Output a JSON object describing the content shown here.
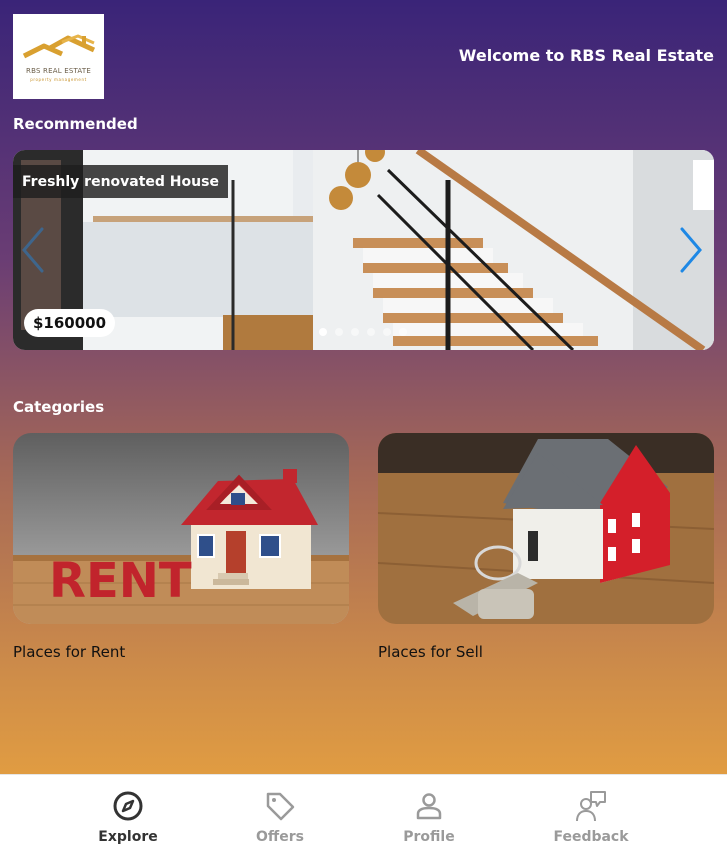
{
  "header": {
    "logo": {
      "name": "RBS REAL ESTATE",
      "tagline": "property management"
    },
    "welcome": "Welcome to RBS Real Estate"
  },
  "recommended": {
    "title": "Recommended",
    "active_slide": 0,
    "slide_count": 6,
    "slides": [
      {
        "caption": "Freshly renovated House",
        "price": "$160000"
      }
    ]
  },
  "categories": {
    "title": "Categories",
    "items": [
      {
        "label": "Places for Rent",
        "sign": "RENT"
      },
      {
        "label": "Places for Sell"
      }
    ]
  },
  "bottom_nav": {
    "active": "Explore",
    "items": [
      {
        "label": "Explore",
        "icon": "compass-icon"
      },
      {
        "label": "Offers",
        "icon": "tag-icon"
      },
      {
        "label": "Profile",
        "icon": "person-icon"
      },
      {
        "label": "Feedback",
        "icon": "feedback-icon"
      }
    ]
  },
  "colors": {
    "gradient_top": "#3a2478",
    "gradient_bottom": "#f0a93c",
    "arrow": "#1e88e5",
    "logo_gold": "#d9a030"
  }
}
